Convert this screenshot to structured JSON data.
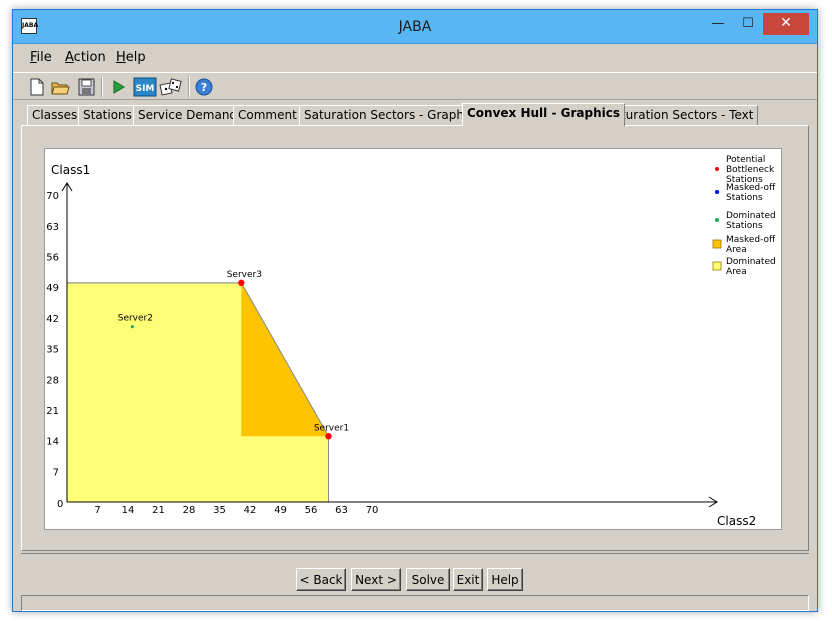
{
  "window": {
    "title": "JABA",
    "icon_text": "JABA",
    "minimize_symbol": "—",
    "maximize_symbol": "☐",
    "close_symbol": "✕"
  },
  "menu": [
    {
      "accel": "F",
      "rest": "ile"
    },
    {
      "accel": "A",
      "rest": "ction"
    },
    {
      "accel": "H",
      "rest": "elp"
    }
  ],
  "toolbar": {
    "icons": [
      "new-file-icon",
      "open-folder-icon",
      "save-icon",
      "run-icon",
      "sim-icon",
      "dice-icon",
      "help-icon"
    ],
    "sim_label": "SIM",
    "help_glyph": "?"
  },
  "tabs": [
    {
      "label": "Classes",
      "active": false
    },
    {
      "label": "Stations",
      "active": false
    },
    {
      "label": "Service Demands",
      "active": false
    },
    {
      "label": "Comment",
      "active": false
    },
    {
      "label": "Saturation Sectors - Graphics",
      "active": false
    },
    {
      "label": "Convex Hull - Graphics",
      "active": true
    },
    {
      "label": "Saturation Sectors - Text",
      "active": false
    }
  ],
  "chart_data": {
    "type": "scatter",
    "xlabel": "Class2",
    "ylabel": "Class1",
    "origin_label": "0",
    "xticks": [
      7,
      14,
      21,
      28,
      35,
      42,
      49,
      56,
      63,
      70
    ],
    "yticks": [
      7,
      14,
      21,
      28,
      35,
      42,
      49,
      56,
      63,
      70
    ],
    "points": [
      {
        "name": "Server1",
        "x": 60,
        "y": 15,
        "type": "Potential Bottleneck Stations",
        "color": "#ff0000"
      },
      {
        "name": "Server2",
        "x": 15,
        "y": 40,
        "type": "Dominated Stations",
        "color": "#22aa55"
      },
      {
        "name": "Server3",
        "x": 40,
        "y": 50,
        "type": "Potential Bottleneck Stations",
        "color": "#ff0000"
      }
    ],
    "dominated_area": {
      "vertices": [
        [
          0,
          0
        ],
        [
          0,
          50
        ],
        [
          40,
          50
        ],
        [
          60,
          15
        ],
        [
          60,
          0
        ]
      ],
      "color": "#ffff77"
    },
    "masked_off_area": {
      "vertices": [
        [
          40,
          50
        ],
        [
          60,
          15
        ],
        [
          40,
          15
        ]
      ],
      "color": "#ffc400"
    },
    "legend": [
      {
        "label": "Potential Bottleneck Stations",
        "lines": [
          "Potential",
          "Bottleneck",
          "Stations"
        ],
        "color": "#ff0000",
        "shape": "dot"
      },
      {
        "label": "Masked-off Stations",
        "lines": [
          "Masked-off",
          "Stations"
        ],
        "color": "#0000ff",
        "shape": "dot"
      },
      {
        "label": "Dominated Stations",
        "lines": [
          "Dominated",
          "Stations"
        ],
        "color": "#22aa55",
        "shape": "dot"
      },
      {
        "label": "Masked-off Area",
        "lines": [
          "Masked-off",
          "Area"
        ],
        "color": "#ffc400",
        "shape": "square"
      },
      {
        "label": "Dominated Area",
        "lines": [
          "Dominated",
          "Area"
        ],
        "color": "#ffff77",
        "shape": "square"
      }
    ],
    "legend_position": "top-right"
  },
  "buttons": {
    "back": "< Back",
    "next": "Next >",
    "solve": "Solve",
    "exit": "Exit",
    "help": "Help"
  }
}
